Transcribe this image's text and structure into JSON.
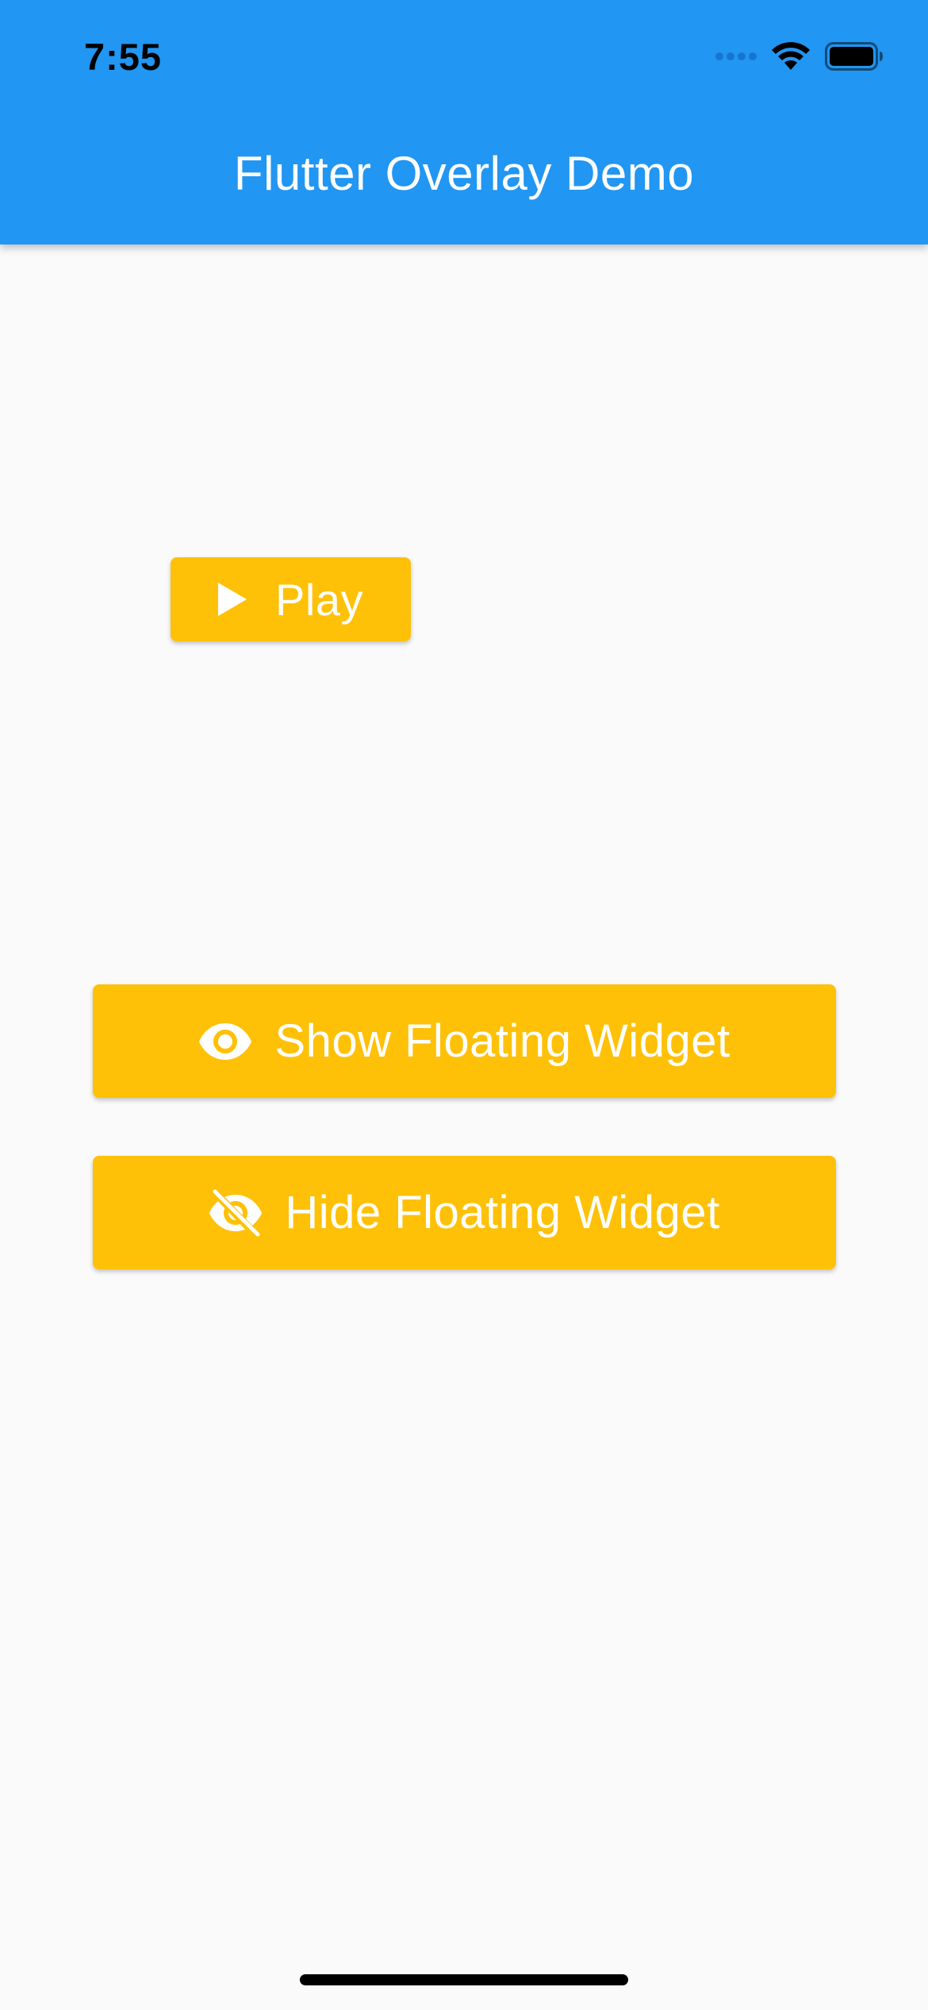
{
  "status_bar": {
    "time": "7:55",
    "icons": [
      "cellular-signal-icon",
      "wifi-icon",
      "battery-icon"
    ]
  },
  "app_bar": {
    "title": "Flutter Overlay Demo",
    "color": "#2196F3"
  },
  "buttons": {
    "play": {
      "label": "Play",
      "icon": "play-icon"
    },
    "show": {
      "label": "Show Floating Widget",
      "icon": "eye-icon"
    },
    "hide": {
      "label": "Hide Floating Widget",
      "icon": "eye-off-icon"
    },
    "color": "#FFC107"
  },
  "colors": {
    "background": "#FAFAFA",
    "button_text": "#FFFFFF"
  }
}
